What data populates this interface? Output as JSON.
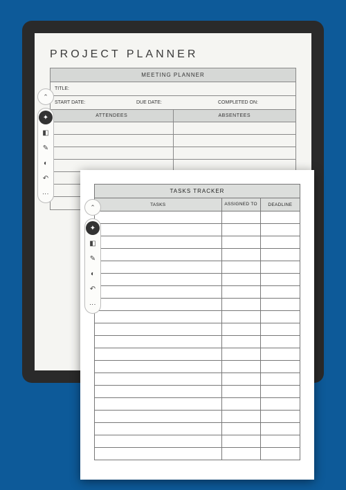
{
  "page1": {
    "title": "PROJECT PLANNER",
    "section_header": "MEETING PLANNER",
    "title_label": "TITLE:",
    "start_date_label": "START DATE:",
    "due_date_label": "DUE DATE:",
    "completed_label": "COMPLETED ON:",
    "attendees_label": "ATTENDEES",
    "absentees_label": "ABSENTEES"
  },
  "page2": {
    "section_header": "TASKS TRACKER",
    "col_tasks": "TASKS",
    "col_assigned": "ASSIGNED TO",
    "col_deadline": "DEADLINE"
  },
  "toolbar": {
    "collapse": "⌃",
    "pen": "✦",
    "eraser": "◧",
    "highlight": "✎",
    "select": "◐",
    "undo": "↶",
    "more": "⋮"
  }
}
